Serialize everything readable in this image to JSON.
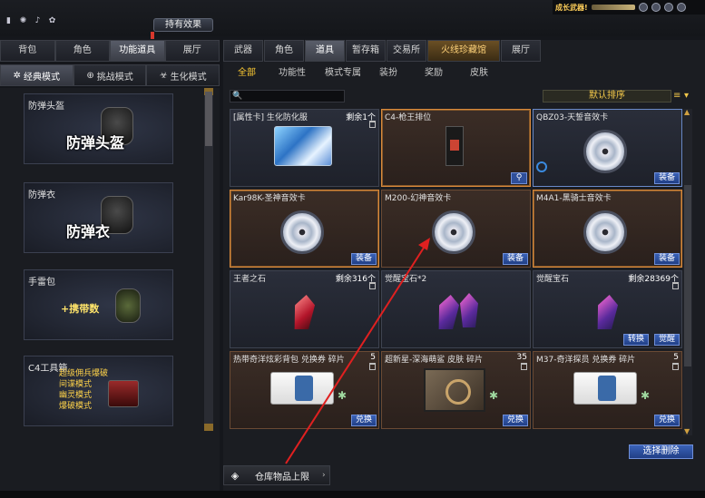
{
  "header": {
    "hold_effect_label": "持有效果",
    "top_right_text": "成长武器!",
    "icons": [
      "bar-chart-icon",
      "swirl-icon",
      "bell-icon",
      "rabbit-icon"
    ]
  },
  "left_nav": {
    "tabs": [
      {
        "label": "背包",
        "active": false
      },
      {
        "label": "角色",
        "active": false
      },
      {
        "label": "功能道具",
        "active": true
      },
      {
        "label": "展厅",
        "active": false
      }
    ],
    "modes": [
      {
        "label": "经典模式",
        "active": true
      },
      {
        "label": "挑战模式",
        "active": false
      },
      {
        "label": "生化模式",
        "active": false
      }
    ],
    "cards": [
      {
        "name": "防弹头盔",
        "big_text": "防弹头盔"
      },
      {
        "name": "防弹衣",
        "big_text": "防弹衣"
      },
      {
        "name": "手雷包",
        "big_text": "+携带数"
      },
      {
        "name": "C4工具箱",
        "modes": [
          "超级佣兵爆破",
          "间谍模式",
          "幽灵模式",
          "爆破模式"
        ]
      }
    ]
  },
  "right_nav": {
    "tabs": [
      {
        "label": "武器",
        "active": false
      },
      {
        "label": "角色",
        "active": false
      },
      {
        "label": "道具",
        "active": true
      },
      {
        "label": "暂存箱",
        "active": false
      },
      {
        "label": "交易所",
        "active": false
      },
      {
        "label": "火线珍藏馆",
        "active": false
      },
      {
        "label": "展厅",
        "active": false
      }
    ],
    "subtabs": [
      {
        "label": "全部",
        "active": true
      },
      {
        "label": "功能性",
        "active": false
      },
      {
        "label": "模式专属",
        "active": false
      },
      {
        "label": "装扮",
        "active": false
      },
      {
        "label": "奖励",
        "active": false
      },
      {
        "label": "皮肤",
        "active": false
      }
    ]
  },
  "search": {
    "placeholder": ""
  },
  "sort": {
    "label": "默认排序"
  },
  "items": [
    {
      "name": "[属性卡] 生化防化服",
      "count": "剩余1个",
      "art": "card",
      "style": "blue",
      "button": ""
    },
    {
      "name": "C4-枪王排位",
      "count": "",
      "art": "phone",
      "style": "brown",
      "button": ""
    },
    {
      "name": "QBZ03-天誓音效卡",
      "count": "",
      "art": "disc",
      "style": "blue",
      "button": "装备"
    },
    {
      "name": "Kar98K-圣神音效卡",
      "count": "",
      "art": "disc",
      "style": "brown",
      "button": "装备"
    },
    {
      "name": "M200-幻神音效卡",
      "count": "",
      "art": "disc",
      "style": "brown",
      "button": "装备"
    },
    {
      "name": "M4A1-黑骑士音效卡",
      "count": "",
      "art": "disc",
      "style": "brown",
      "button": "装备"
    },
    {
      "name": "王者之石",
      "count": "剩余316个",
      "art": "gem-red",
      "style": "blue",
      "button": ""
    },
    {
      "name": "觉醒宝石*2",
      "count": "",
      "art": "gem2",
      "style": "blue",
      "button": ""
    },
    {
      "name": "觉醒宝石",
      "count": "剩余28369个",
      "art": "gem",
      "style": "blue",
      "button": "觉醒",
      "button2": "转换"
    },
    {
      "name": "热带奇洋炫彩背包 兑换券 碎片",
      "count": "5",
      "art": "ticket",
      "style": "brown",
      "button": "兑换"
    },
    {
      "name": "超新星-深海萌鲨 皮肤 碎片",
      "count": "35",
      "art": "skin",
      "style": "brown",
      "button": "兑换"
    },
    {
      "name": "M37-奇洋探员 兑换券 碎片",
      "count": "5",
      "art": "ticket",
      "style": "brown",
      "button": "兑换"
    }
  ],
  "footer": {
    "delete_selected_label": "选择删除",
    "storage_limit_label": "仓库物品上限"
  }
}
